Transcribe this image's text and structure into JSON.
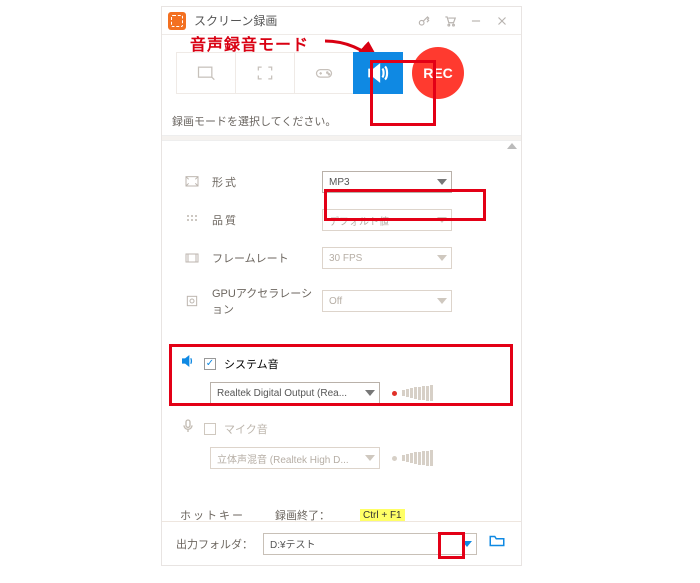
{
  "titlebar": {
    "title": "スクリーン録画"
  },
  "annotation": {
    "text": "音声録音モード"
  },
  "subtitle": "録画モードを選択してください。",
  "rec_label": "REC",
  "form": {
    "format": {
      "label": "形式",
      "value": "MP3"
    },
    "quality": {
      "label": "品質",
      "value": "デフォルト値"
    },
    "framerate": {
      "label": "フレームレート",
      "value": "30 FPS"
    },
    "gpu": {
      "label": "GPUアクセラレーション",
      "value": "Off"
    }
  },
  "system_audio": {
    "label": "システム音",
    "device": "Realtek Digital Output (Rea..."
  },
  "mic_audio": {
    "label": "マイク音",
    "device": "立体声混音 (Realtek High D..."
  },
  "hotkey": {
    "label": "ホットキー",
    "item_label": "録画終了：",
    "key": "Ctrl + F1"
  },
  "footer": {
    "label": "出力フォルダ：",
    "path": "D:¥テスト"
  }
}
